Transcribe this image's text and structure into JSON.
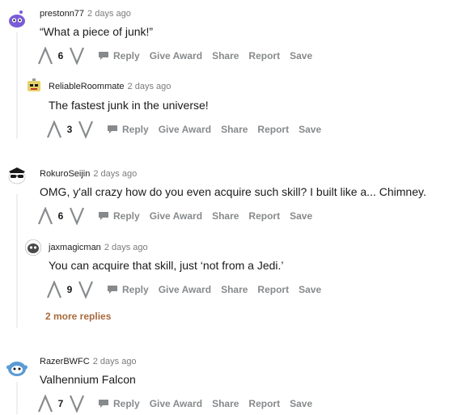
{
  "comments": [
    {
      "user": "prestonn77",
      "time": "2 days ago",
      "text": "“What a piece of junk!”",
      "score": "6",
      "replies": [
        {
          "user": "ReliableRoommate",
          "time": "2 days ago",
          "text": "The fastest junk in the universe!",
          "score": "3"
        }
      ]
    },
    {
      "user": "RokuroSeijin",
      "time": "2 days ago",
      "text": "OMG, y'all crazy how do you even acquire such skill? I built like a... Chimney.",
      "score": "6",
      "replies": [
        {
          "user": "jaxmagicman",
          "time": "2 days ago",
          "text": "You can acquire that skill, just ‘not from a Jedi.’",
          "score": "9"
        }
      ],
      "more_replies": "2 more replies"
    },
    {
      "user": "RazerBWFC",
      "time": "2 days ago",
      "text": "Valhennium Falcon",
      "score": "7"
    }
  ],
  "actions": {
    "reply": "Reply",
    "give_award": "Give Award",
    "share": "Share",
    "report": "Report",
    "save": "Save"
  },
  "icons": {
    "upvote": "upvote-arrow-icon",
    "downvote": "downvote-arrow-icon",
    "reply": "comment-bubble-icon"
  },
  "colors": {
    "meta_gray": "#7c7c7c",
    "action_gray": "#878a8c",
    "more_replies": "#a86a3c",
    "thread_line": "#edeff1"
  }
}
